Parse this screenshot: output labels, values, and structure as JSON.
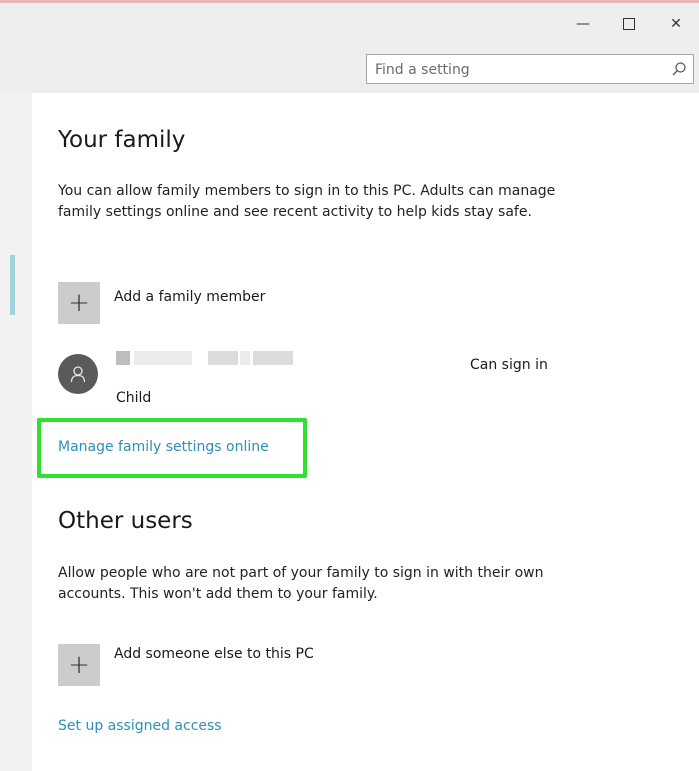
{
  "window": {
    "minimize_glyph": "—",
    "close_glyph": "✕"
  },
  "search": {
    "placeholder": "Find a setting"
  },
  "family": {
    "heading": "Your family",
    "description": "You can allow family members to sign in to this PC. Adults can manage family settings online and see recent activity to help kids stay safe.",
    "add_member_label": "Add a family member",
    "member": {
      "role": "Child",
      "status": "Can sign in"
    },
    "manage_link": "Manage family settings online"
  },
  "other_users": {
    "heading": "Other users",
    "description": "Allow people who are not part of your family to sign in with their own accounts. This won't add them to your family.",
    "add_label": "Add someone else to this PC",
    "assigned_access_link": "Set up assigned access"
  },
  "colors": {
    "link": "#2e8fb8",
    "highlight": "#2fe02f",
    "tile": "#cccccc"
  }
}
